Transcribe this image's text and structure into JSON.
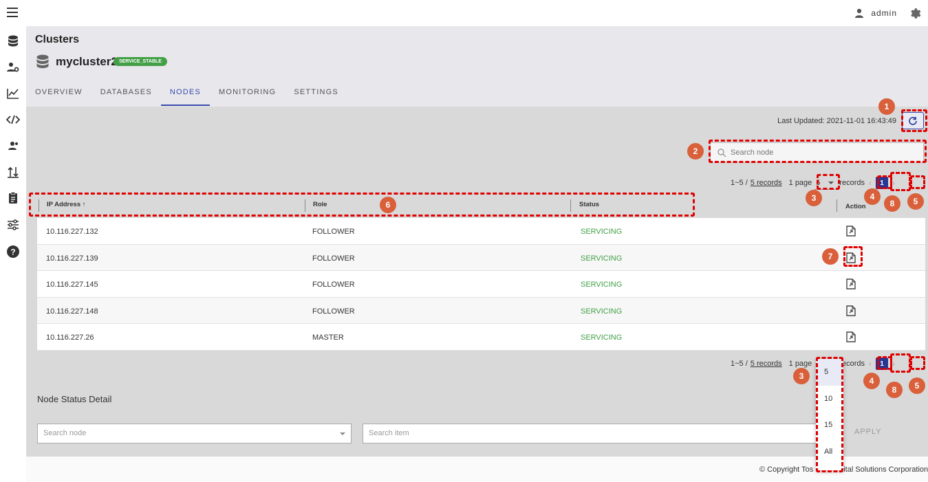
{
  "topbar": {
    "username": "admin"
  },
  "sidebar": {
    "icons": [
      "database-icon",
      "user-settings-icon",
      "chart-icon",
      "code-icon",
      "users-icon",
      "transfer-icon",
      "clipboard-icon",
      "sliders-icon",
      "help-icon"
    ]
  },
  "header": {
    "breadcrumb": "Clusters",
    "cluster_name": "mycluster2",
    "cluster_status": "SERVICE_STABLE",
    "tabs": [
      "OVERVIEW",
      "DATABASES",
      "NODES",
      "MONITORING",
      "SETTINGS"
    ],
    "active_tab": "NODES"
  },
  "toolbar": {
    "last_updated": "Last Updated: 2021-11-01 16:43:49",
    "search_placeholder": "Search node"
  },
  "pagination": {
    "range": "1~5 /",
    "records_link": "5 records",
    "pages": "1 page",
    "per_page": "5",
    "records_label": "records",
    "current_page": "1",
    "prev": "‹",
    "next": "›"
  },
  "table": {
    "columns": [
      "IP Address ↑",
      "Role",
      "Status",
      "Action"
    ],
    "rows": [
      {
        "ip": "10.116.227.132",
        "role": "FOLLOWER",
        "status": "SERVICING"
      },
      {
        "ip": "10.116.227.139",
        "role": "FOLLOWER",
        "status": "SERVICING"
      },
      {
        "ip": "10.116.227.145",
        "role": "FOLLOWER",
        "status": "SERVICING"
      },
      {
        "ip": "10.116.227.148",
        "role": "FOLLOWER",
        "status": "SERVICING"
      },
      {
        "ip": "10.116.227.26",
        "role": "MASTER",
        "status": "SERVICING"
      }
    ]
  },
  "detail": {
    "title": "Node Status Detail",
    "node_placeholder": "Search node",
    "item_placeholder": "Search item",
    "apply_label": "APPLY"
  },
  "per_page_dropdown": {
    "options": [
      "5",
      "10",
      "15",
      "All"
    ],
    "selected": "5"
  },
  "footer": {
    "left": "© Copyright Tos",
    "right": "ital Solutions Corporation"
  },
  "annotations": {
    "markers": [
      "1",
      "2",
      "3",
      "4",
      "5",
      "6",
      "7",
      "8",
      "3",
      "4",
      "8",
      "5"
    ],
    "marker_color": "#d9603b",
    "highlight_color": "#e00000"
  }
}
